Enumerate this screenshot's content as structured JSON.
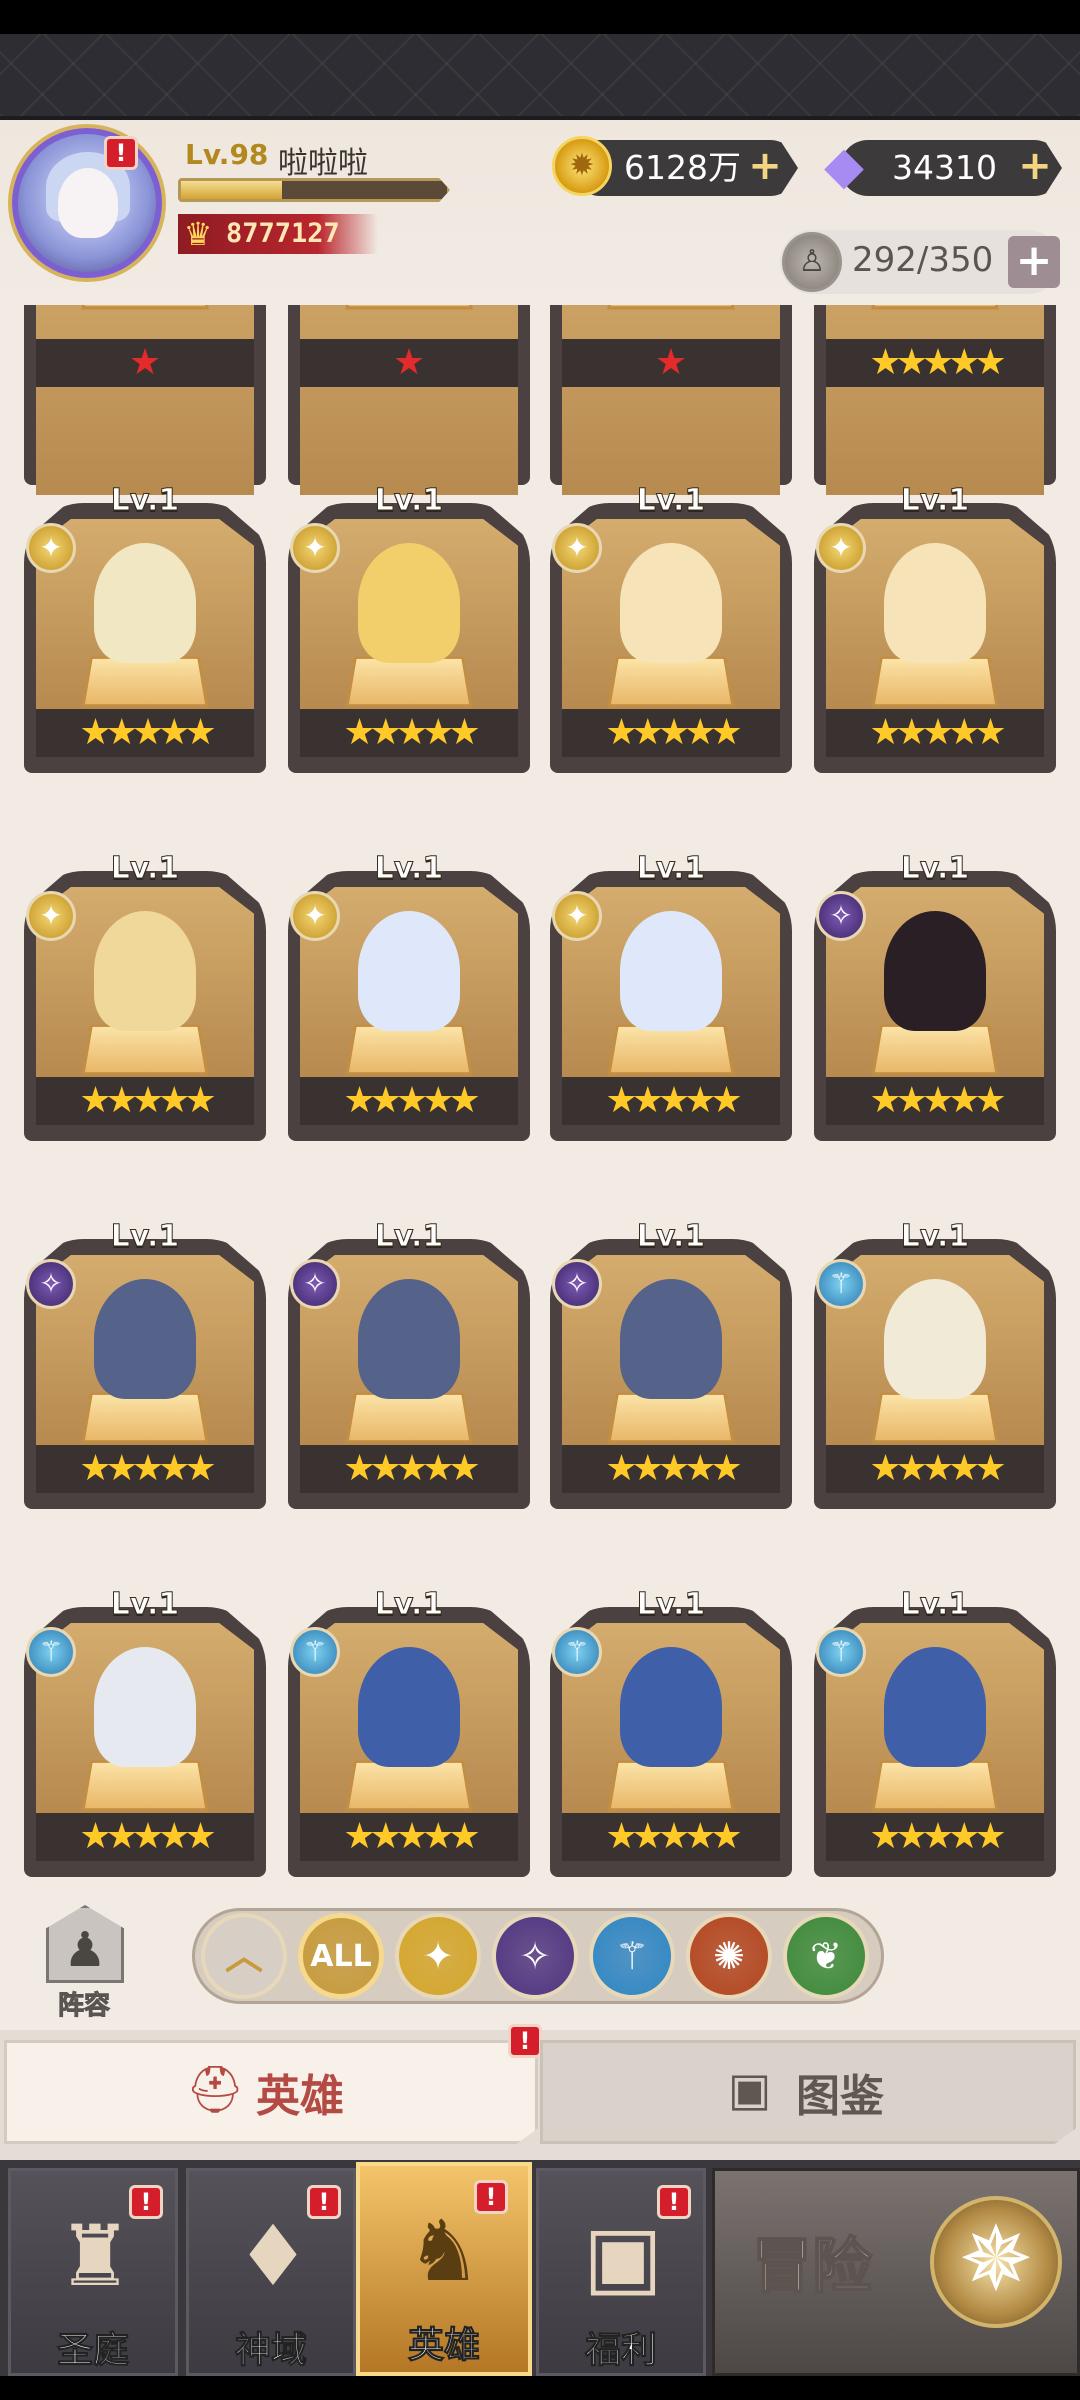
{
  "player": {
    "level": "Lv.98",
    "name": "啦啦啦",
    "power": "8777127",
    "xp_fraction": 0.38
  },
  "currency": {
    "gold": "6128万",
    "gems": "34310"
  },
  "roster": {
    "count": "292/350"
  },
  "icons": {
    "gold": "gold-coin-icon",
    "gem": "diamond-icon",
    "roster": "hero-slot-icon",
    "plus": "plus-icon",
    "alert": "alert-badge-icon"
  },
  "colors": {
    "accent_gold": "#d4a336",
    "alert_red": "#d51e2b",
    "power_red": "#b9262e",
    "star": "#ffca28"
  },
  "partial_row": [
    {
      "stars": "★",
      "star_color": "red"
    },
    {
      "stars": "★",
      "star_color": "red"
    },
    {
      "stars": "★",
      "star_color": "red"
    },
    {
      "stars": "★★★★★",
      "star_color": "gold"
    }
  ],
  "heroes": [
    {
      "level": "Lv.1",
      "class": "holy",
      "stars": "★★★★★",
      "tint": "#f1e7c2"
    },
    {
      "level": "Lv.1",
      "class": "holy",
      "stars": "★★★★★",
      "tint": "#f3cf6b"
    },
    {
      "level": "Lv.1",
      "class": "holy",
      "stars": "★★★★★",
      "tint": "#f6e4b8"
    },
    {
      "level": "Lv.1",
      "class": "holy",
      "stars": "★★★★★",
      "tint": "#f6e4b8"
    },
    {
      "level": "Lv.1",
      "class": "holy",
      "stars": "★★★★★",
      "tint": "#f0d79a"
    },
    {
      "level": "Lv.1",
      "class": "holy",
      "stars": "★★★★★",
      "tint": "#dfe7fb"
    },
    {
      "level": "Lv.1",
      "class": "holy",
      "stars": "★★★★★",
      "tint": "#dfe7fb"
    },
    {
      "level": "Lv.1",
      "class": "dark",
      "stars": "★★★★★",
      "tint": "#2a1f24"
    },
    {
      "level": "Lv.1",
      "class": "dark",
      "stars": "★★★★★",
      "tint": "#55628a"
    },
    {
      "level": "Lv.1",
      "class": "dark",
      "stars": "★★★★★",
      "tint": "#55628a"
    },
    {
      "level": "Lv.1",
      "class": "dark",
      "stars": "★★★★★",
      "tint": "#55628a"
    },
    {
      "level": "Lv.1",
      "class": "ice",
      "stars": "★★★★★",
      "tint": "#f0ead6"
    },
    {
      "level": "Lv.1",
      "class": "ice",
      "stars": "★★★★★",
      "tint": "#e6e9f0"
    },
    {
      "level": "Lv.1",
      "class": "ice",
      "stars": "★★★★★",
      "tint": "#3f5fa8"
    },
    {
      "level": "Lv.1",
      "class": "ice",
      "stars": "★★★★★",
      "tint": "#3f5fa8"
    },
    {
      "level": "Lv.1",
      "class": "ice",
      "stars": "★★★★★",
      "tint": "#3f5fa8"
    }
  ],
  "class_icons": {
    "holy": "✦",
    "dark": "✧",
    "ice": "⚚"
  },
  "filter": {
    "lineup_label": "阵容",
    "buttons": [
      {
        "id": "collapse",
        "label": "︿",
        "icon": "chevron-up-icon",
        "color": "#d7cfc6"
      },
      {
        "id": "all",
        "label": "ALL",
        "icon": "all-icon",
        "color": "#c79a3a"
      },
      {
        "id": "holy",
        "label": "✦",
        "icon": "holy-class-icon",
        "color": "#d5a62a"
      },
      {
        "id": "dark",
        "label": "✧",
        "icon": "dark-class-icon",
        "color": "#4f3481"
      },
      {
        "id": "ice",
        "label": "⚚",
        "icon": "knight-class-icon",
        "color": "#2f86c4"
      },
      {
        "id": "fire",
        "label": "✺",
        "icon": "beast-class-icon",
        "color": "#b3451f"
      },
      {
        "id": "nature",
        "label": "❦",
        "icon": "nature-class-icon",
        "color": "#3c8a3a"
      }
    ]
  },
  "tabs": {
    "heroes": "英雄",
    "codex": "图鉴"
  },
  "nav": [
    {
      "label": "圣庭",
      "icon": "castle-icon",
      "glyph": "♜"
    },
    {
      "label": "神域",
      "icon": "crystal-icon",
      "glyph": "♦"
    },
    {
      "label": "英雄",
      "icon": "helmet-icon",
      "glyph": "♞"
    },
    {
      "label": "福利",
      "icon": "chest-icon",
      "glyph": "▣"
    }
  ],
  "adventure": {
    "label": "冒险",
    "icon": "compass-icon"
  }
}
